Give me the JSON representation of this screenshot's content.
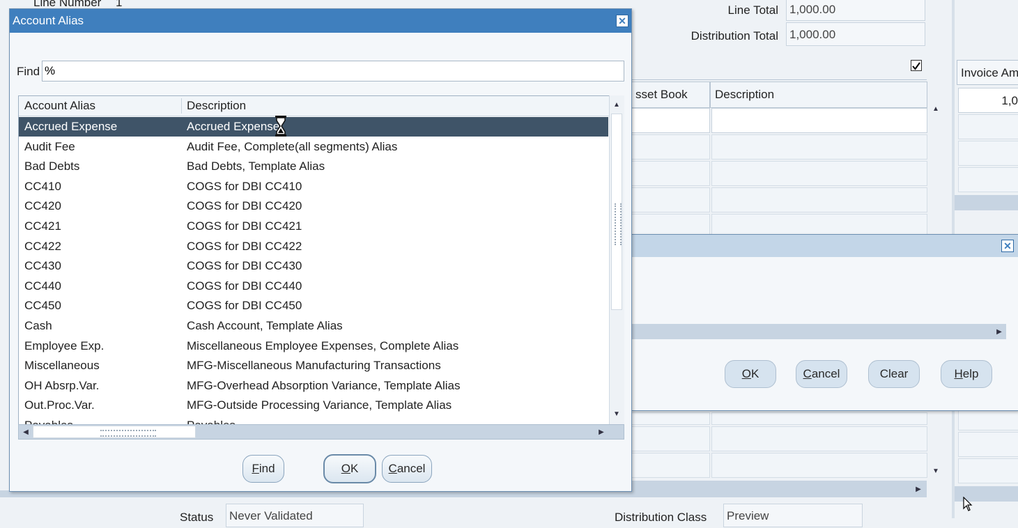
{
  "background_form": {
    "line_number_label": "Line Number",
    "line_number_value": "1",
    "line_total_label": "Line Total",
    "line_total_value": "1,000.00",
    "distribution_total_label": "Distribution Total",
    "distribution_total_value": "1,000.00",
    "checkbox_checked": true,
    "columns": {
      "asset_book": "sset Book",
      "description": "Description"
    },
    "invoice_amount_header": "Invoice Am",
    "invoice_amount_value": "1,0",
    "status_label": "Status",
    "status_value": "Never Validated",
    "distribution_class_label": "Distribution Class",
    "distribution_class_value": "Preview"
  },
  "account_alias_dialog": {
    "title": "Account Alias",
    "close_glyph": "✕",
    "find_label": "Find",
    "find_value": "%",
    "columns": [
      "Account Alias",
      "Description"
    ],
    "rows": [
      {
        "alias": "Accrued Expense",
        "description": "Accrued Expense",
        "selected": true
      },
      {
        "alias": "Audit Fee",
        "description": "Audit Fee, Complete(all segments) Alias"
      },
      {
        "alias": "Bad Debts",
        "description": "Bad Debts, Template Alias"
      },
      {
        "alias": "CC410",
        "description": "COGS for DBI CC410"
      },
      {
        "alias": "CC420",
        "description": "COGS for DBI CC420"
      },
      {
        "alias": "CC421",
        "description": "COGS for DBI CC421"
      },
      {
        "alias": "CC422",
        "description": "COGS for DBI CC422"
      },
      {
        "alias": "CC430",
        "description": "COGS for DBI CC430"
      },
      {
        "alias": "CC440",
        "description": "COGS for DBI CC440"
      },
      {
        "alias": "CC450",
        "description": "COGS for DBI CC450"
      },
      {
        "alias": "Cash",
        "description": "Cash Account, Template Alias"
      },
      {
        "alias": "Employee Exp.",
        "description": "Miscellaneous Employee Expenses, Complete Alias"
      },
      {
        "alias": "Miscellaneous",
        "description": "MFG-Miscellaneous Manufacturing Transactions"
      },
      {
        "alias": "OH Absrp.Var.",
        "description": "MFG-Overhead Absorption Variance, Template Alias"
      },
      {
        "alias": "Out.Proc.Var.",
        "description": "MFG-Outside Processing Variance, Template Alias"
      },
      {
        "alias": "Payables",
        "description": "Payables"
      }
    ],
    "buttons": {
      "find_key": "F",
      "find_rest": "ind",
      "ok_key": "O",
      "ok_rest": "K",
      "cancel_key": "C",
      "cancel_rest": "ancel"
    }
  },
  "rear_dialog": {
    "close_glyph": "✕",
    "buttons": {
      "ok_key": "O",
      "ok_rest": "K",
      "cancel_key": "C",
      "cancel_rest": "ancel",
      "clear_label": "Clear",
      "help_key": "H",
      "help_rest": "elp"
    }
  },
  "icons": {
    "checkbox": "check-icon",
    "scroll_up": "▲",
    "scroll_down": "▼",
    "scroll_left": "◀",
    "scroll_right": "▶",
    "hourglass": "hourglass-icon",
    "cursor": "arrow-cursor-icon"
  },
  "colors": {
    "titlebar": "#3f7fbe",
    "selected_row": "#3f5468",
    "background": "#eef2f6"
  }
}
